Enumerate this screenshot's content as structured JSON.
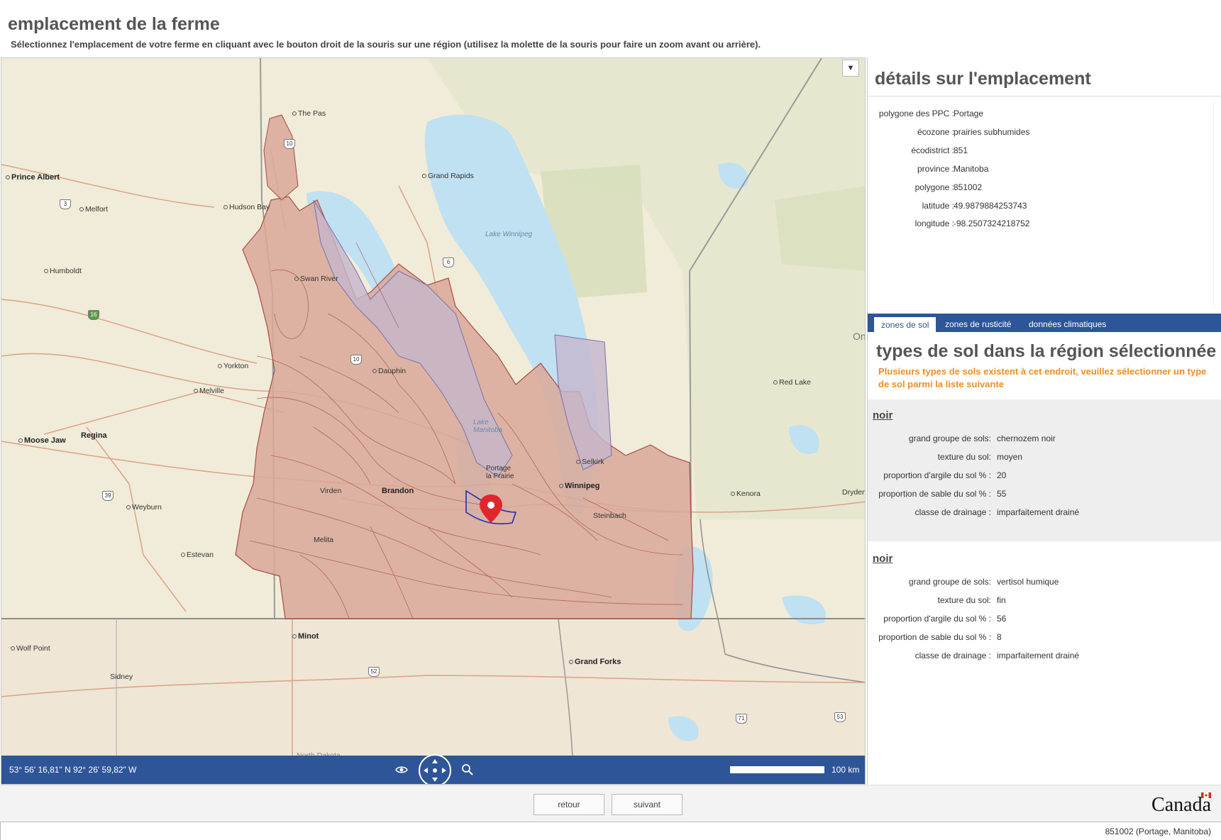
{
  "header": {
    "title": "emplacement de la ferme",
    "instructions": "Sélectionnez l'emplacement de votre ferme en cliquant avec le bouton droit de la souris sur une région (utilisez la molette de la souris pour faire un zoom avant ou arrière)."
  },
  "map": {
    "menu_icon": "▼",
    "places": [
      {
        "name": "The Pas",
        "style": "normal"
      },
      {
        "name": "Prince Albert",
        "style": "bold"
      },
      {
        "name": "Grand Rapids",
        "style": "normal"
      },
      {
        "name": "Melfort",
        "style": "normal"
      },
      {
        "name": "Hudson Bay",
        "style": "normal"
      },
      {
        "name": "Humboldt",
        "style": "normal"
      },
      {
        "name": "Swan River",
        "style": "normal"
      },
      {
        "name": "Yorkton",
        "style": "normal"
      },
      {
        "name": "Melville",
        "style": "normal"
      },
      {
        "name": "Dauphin",
        "style": "normal"
      },
      {
        "name": "Moose Jaw",
        "style": "bold"
      },
      {
        "name": "Regina",
        "style": "bold"
      },
      {
        "name": "Weyburn",
        "style": "normal"
      },
      {
        "name": "Estevan",
        "style": "normal"
      },
      {
        "name": "Virden",
        "style": "normal"
      },
      {
        "name": "Brandon",
        "style": "bold"
      },
      {
        "name": "Melita",
        "style": "normal"
      },
      {
        "name": "Winnipeg",
        "style": "bold"
      },
      {
        "name": "Selkirk",
        "style": "normal"
      },
      {
        "name": "Steinbach",
        "style": "normal"
      },
      {
        "name": "Kenora",
        "style": "normal"
      },
      {
        "name": "Dryden",
        "style": "normal"
      },
      {
        "name": "Red Lake",
        "style": "normal"
      },
      {
        "name": "Minot",
        "style": "bold"
      },
      {
        "name": "Wolf Point",
        "style": "normal"
      },
      {
        "name": "Sidney",
        "style": "normal"
      },
      {
        "name": "Grand Forks",
        "style": "bold"
      },
      {
        "name": "North Dakota",
        "style": "normal"
      },
      {
        "name": "Portage la Prairie",
        "style": "normal"
      },
      {
        "name": "On",
        "style": "normal"
      }
    ],
    "water_labels": [
      "Lake Winnipeg",
      "Lake Manitoba"
    ],
    "shields": [
      "10",
      "3",
      "16",
      "39",
      "6",
      "10",
      "52",
      "71",
      "53"
    ],
    "coords_readout": "53° 56' 16,81\" N 92° 26' 59,82\" W",
    "scale_label": "100 km",
    "colors": {
      "land": "#f1ecd9",
      "water": "#bfe1f2",
      "soil_polygon": "#d9a898",
      "soil_edge": "#a84a44",
      "alt_polygon": "#c6b6cc",
      "toolbar": "#2e5597",
      "pin": "#e0262c"
    }
  },
  "details": {
    "title": "détails sur l'emplacement",
    "rows": [
      {
        "label": "polygone des PPC :",
        "value": "Portage"
      },
      {
        "label": "écozone :",
        "value": "prairies subhumides"
      },
      {
        "label": "écodistrict :",
        "value": "851"
      },
      {
        "label": "province :",
        "value": "Manitoba"
      },
      {
        "label": "polygone :",
        "value": "851002"
      },
      {
        "label": "latitude :",
        "value": "49.9879884253743"
      },
      {
        "label": "longitude :",
        "value": "-98.2507324218752"
      }
    ]
  },
  "tabs": [
    {
      "label": "zones de sol",
      "active": true
    },
    {
      "label": "zones de rusticité",
      "active": false
    },
    {
      "label": "données climatiques",
      "active": false
    }
  ],
  "soil": {
    "title": "types de sol dans la région sélectionnée",
    "note": "Plusieurs types de sols existent à cet endroit, veuillez sélectionner un type de sol parmi la liste suivante",
    "cards": [
      {
        "name": "noir",
        "rows": [
          {
            "label": "grand groupe de sols:",
            "value": "chernozem noir"
          },
          {
            "label": "texture du sol:",
            "value": "moyen"
          },
          {
            "label": "proportion d'argile du sol % :",
            "value": "20"
          },
          {
            "label": "proportion de sable du sol % :",
            "value": "55"
          },
          {
            "label": "classe de drainage :",
            "value": " imparfaitement drainé"
          }
        ]
      },
      {
        "name": "noir",
        "rows": [
          {
            "label": "grand groupe de sols:",
            "value": "vertisol humique"
          },
          {
            "label": "texture du sol:",
            "value": "fin"
          },
          {
            "label": "proportion d'argile du sol % :",
            "value": "56"
          },
          {
            "label": "proportion de sable du sol % :",
            "value": "8"
          },
          {
            "label": "classe de drainage :",
            "value": " imparfaitement drainé"
          }
        ]
      }
    ]
  },
  "footer": {
    "back_label": "retour",
    "next_label": "suivant",
    "wordmark": "Canada",
    "status": "851002 (Portage, Manitoba)"
  }
}
